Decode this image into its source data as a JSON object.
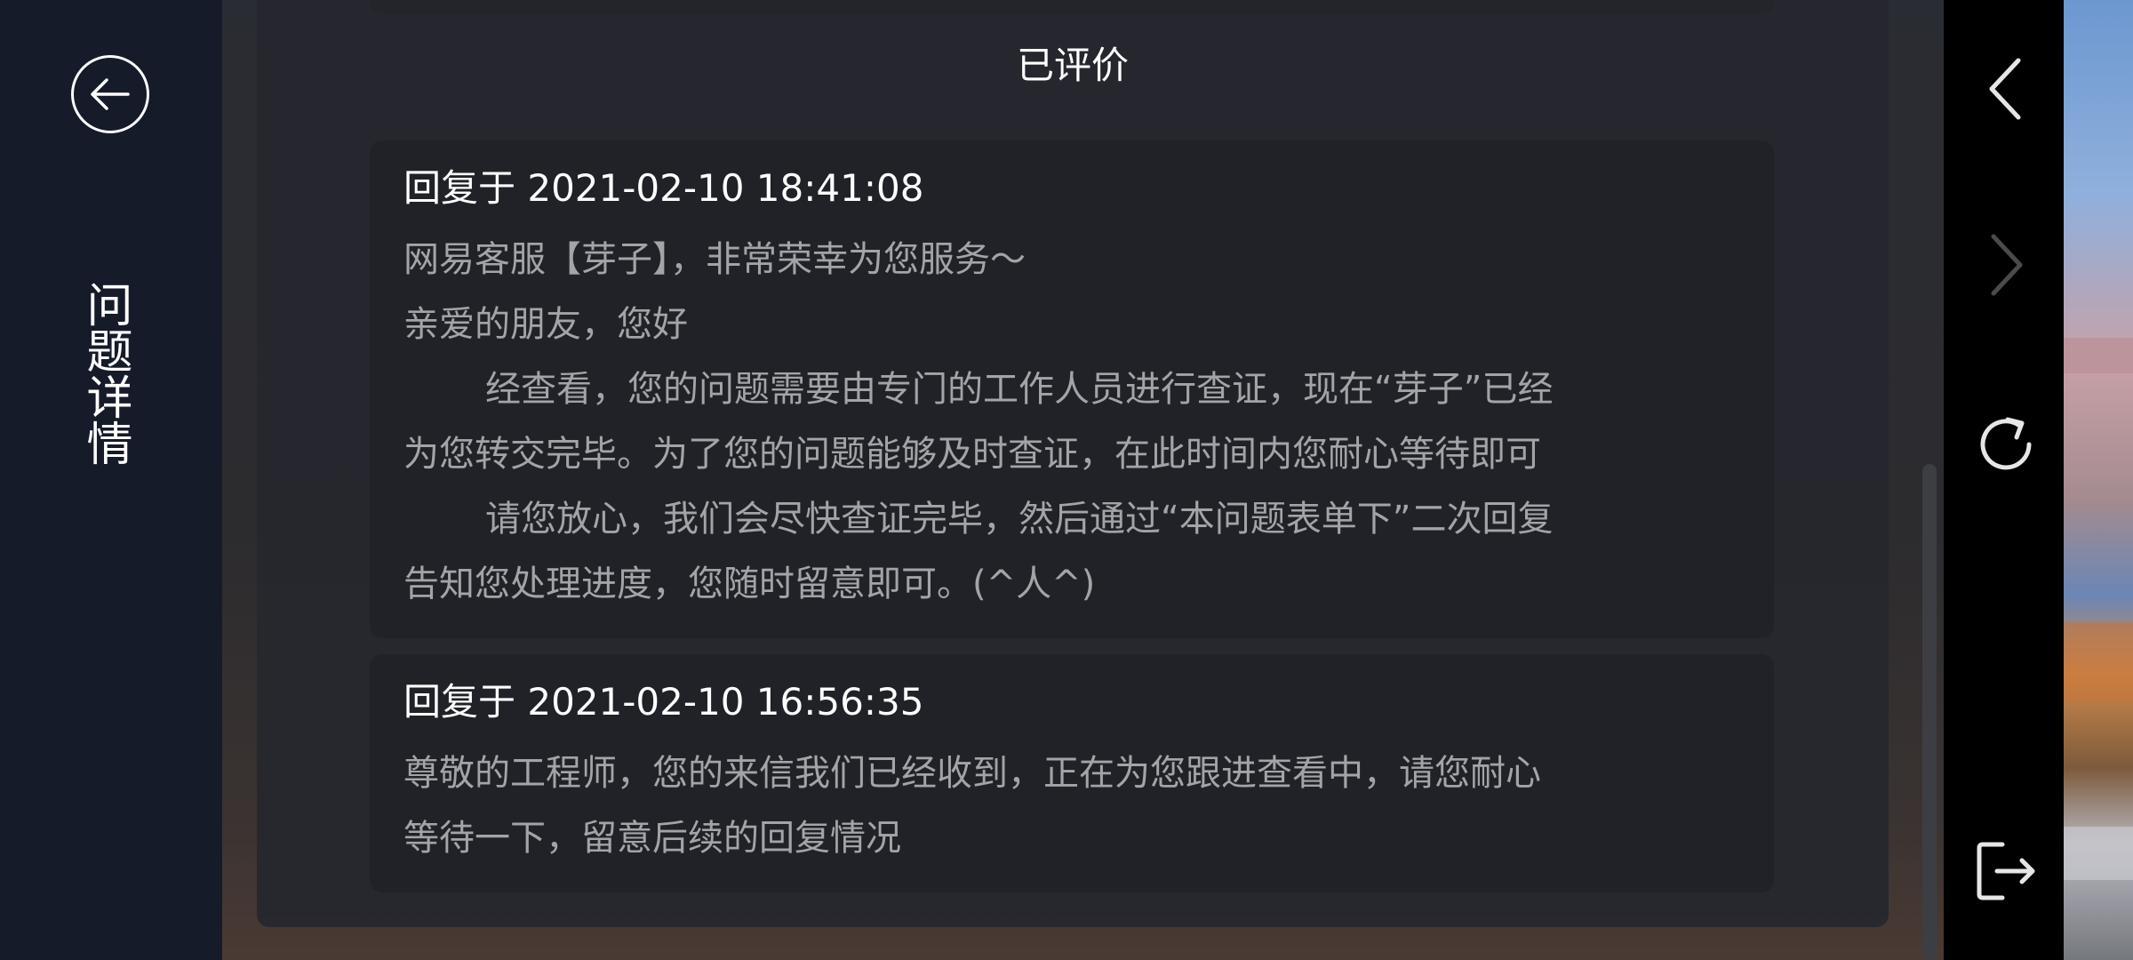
{
  "sidebar": {
    "title": "问题详情"
  },
  "section": {
    "heading": "已评价"
  },
  "replies": [
    {
      "time_label": "回复于 2021-02-10 18:41:08",
      "lines": [
        "网易客服【芽子】，非常荣幸为您服务～",
        "亲爱的朋友，您好",
        "经查看，您的问题需要由专门的工作人员进行查证，现在“芽子”已经",
        "为您转交完毕。为了您的问题能够及时查证，在此时间内您耐心等待即可",
        "请您放心，我们会尽快查证完毕，然后通过“本问题表单下”二次回复",
        "告知您处理进度，您随时留意即可。(^人^)"
      ]
    },
    {
      "time_label": "回复于 2021-02-10 16:56:35",
      "lines": [
        "尊敬的工程师，您的来信我们已经收到，正在为您跟进查看中，请您耐心",
        "等待一下，留意后续的回复情况"
      ]
    }
  ],
  "icons": {
    "back": "arrow-left-circle-icon",
    "nav_back": "chevron-left-icon",
    "nav_forward": "chevron-right-icon",
    "nav_refresh": "refresh-icon",
    "nav_exit": "exit-icon"
  },
  "colors": {
    "sidebar_bg": "#161b2a",
    "panel_bg": "#26282e",
    "card_bg": "#202227",
    "title_text": "#ffffff",
    "body_text": "#a3a4a8",
    "nav_icon_active": "#e6e6e6",
    "nav_icon_disabled": "#4a4a4a"
  }
}
